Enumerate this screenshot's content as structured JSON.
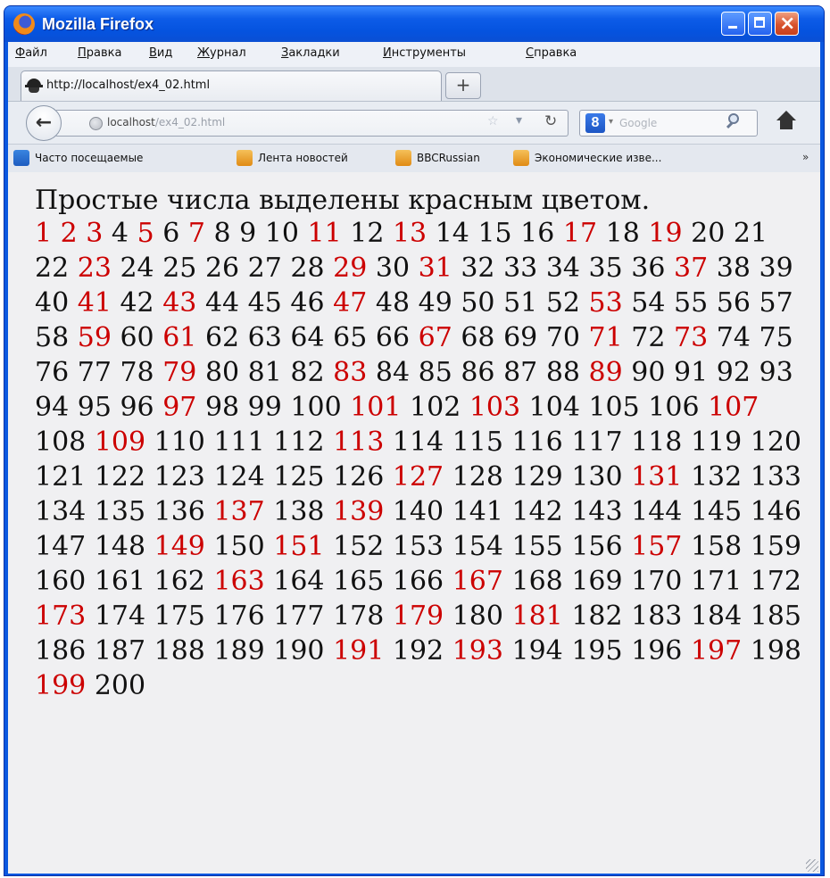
{
  "window": {
    "title": "Mozilla Firefox"
  },
  "menu": [
    "Файл",
    "Правка",
    "Вид",
    "Журнал",
    "Закладки",
    "Инструменты",
    "Справка"
  ],
  "tab": {
    "title": "http://localhost/ex4_02.html",
    "new_tab_symbol": "+"
  },
  "nav": {
    "url_host": "localhost",
    "url_path": "/ex4_02.html",
    "search_engine_letter": "8",
    "search_placeholder": "Google"
  },
  "bookmarks": [
    "Часто посещаемые",
    "Лента новостей",
    "BBCRussian",
    "Экономические изве..."
  ],
  "bookmarks_more": "»",
  "page": {
    "heading": "Простые числа выделены красным цветом.",
    "range_start": 1,
    "range_end": 200,
    "primes": [
      1,
      2,
      3,
      5,
      7,
      11,
      13,
      17,
      19,
      23,
      29,
      31,
      37,
      41,
      43,
      47,
      53,
      59,
      61,
      67,
      71,
      73,
      79,
      83,
      89,
      97,
      101,
      103,
      107,
      109,
      113,
      127,
      131,
      137,
      139,
      149,
      151,
      157,
      163,
      167,
      173,
      179,
      181,
      191,
      193,
      197,
      199
    ],
    "prime_color": "#cc0000",
    "normal_color": "#111111"
  },
  "colors": {
    "titlebar": "#0a58e0",
    "page_bg": "#f0f0f2"
  }
}
